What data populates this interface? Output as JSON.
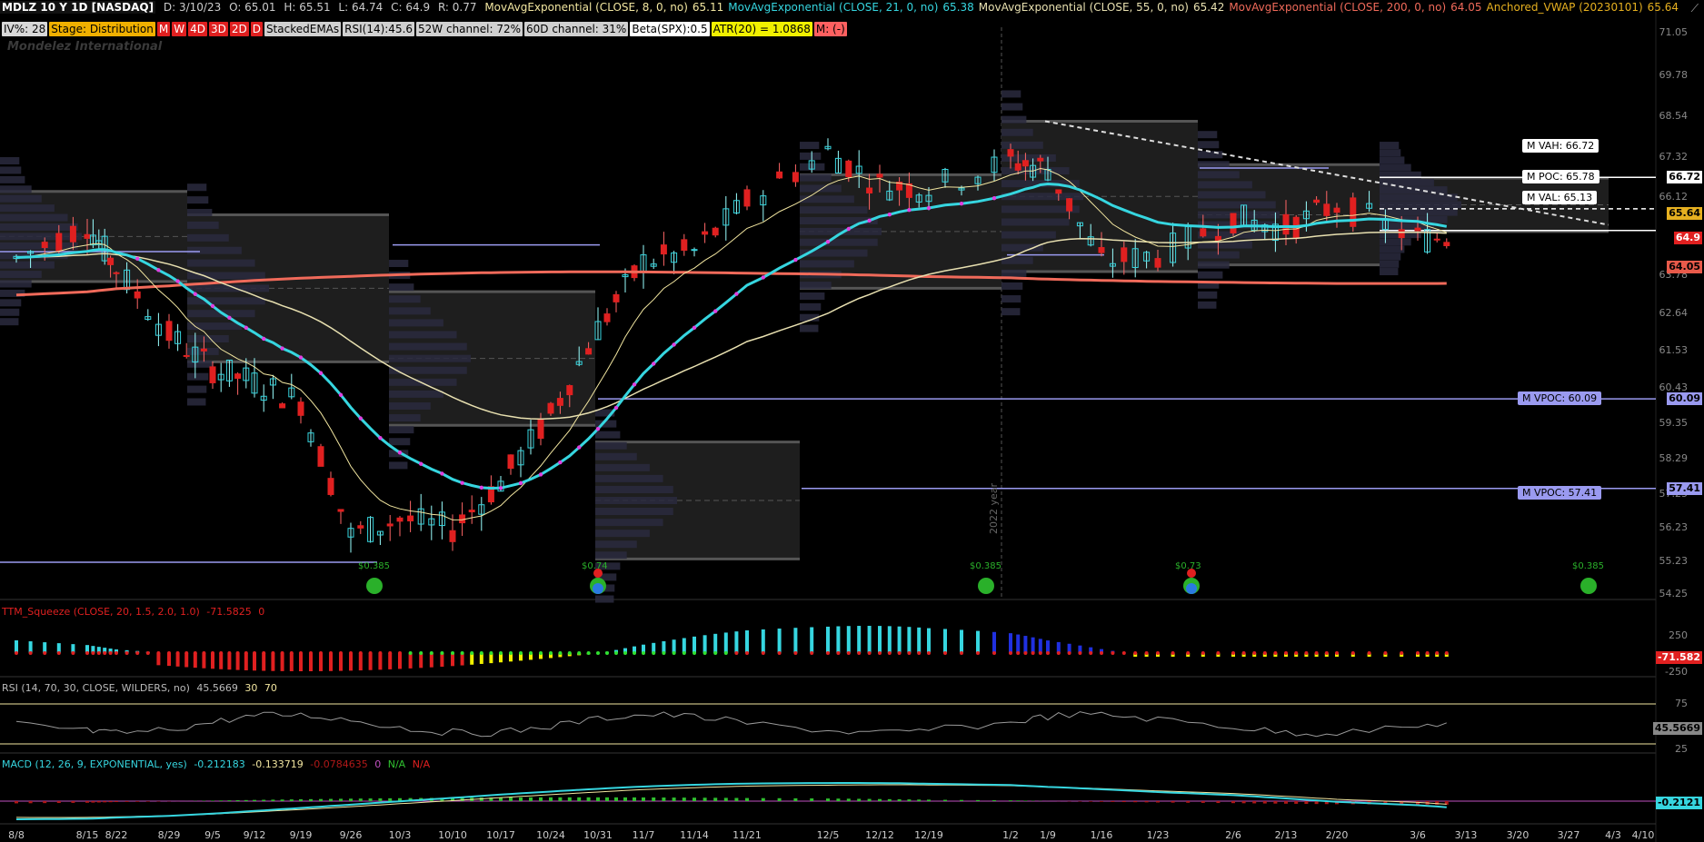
{
  "header": {
    "symbol": "MDLZ 10 Y 1D [NASDAQ]",
    "ohlc": [
      "D: 3/10/23",
      "O: 65.01",
      "H: 65.51",
      "L: 64.74",
      "C: 64.9",
      "R: 0.77"
    ],
    "studies": [
      {
        "label": "MovAvgExponential (CLOSE, 8, 0, no)",
        "value": "65.11",
        "color": "#f2e6a0"
      },
      {
        "label": "MovAvgExponential (CLOSE, 21, 0, no)",
        "value": "65.38",
        "color": "#36d6e0"
      },
      {
        "label": "MovAvgExponential (CLOSE, 55, 0, no)",
        "value": "65.42",
        "color": "#e8e0b0"
      },
      {
        "label": "MovAvgExponential (CLOSE, 200, 0, no)",
        "value": "64.05",
        "color": "#f06a5a"
      },
      {
        "label": "Anchored_VWAP (20230101)",
        "value": "65.64",
        "color": "#e6b020"
      }
    ]
  },
  "badges": [
    {
      "text": "IV%: 28",
      "bg": "#d8d8d8",
      "fg": "#000"
    },
    {
      "text": "Stage: Distribution",
      "bg": "#f0b000",
      "fg": "#000"
    },
    {
      "text": "M",
      "bg": "#e02020",
      "fg": "#fff"
    },
    {
      "text": "W",
      "bg": "#e02020",
      "fg": "#fff"
    },
    {
      "text": "4D",
      "bg": "#e02020",
      "fg": "#fff"
    },
    {
      "text": "3D",
      "bg": "#e02020",
      "fg": "#fff"
    },
    {
      "text": "2D",
      "bg": "#e02020",
      "fg": "#fff"
    },
    {
      "text": "D",
      "bg": "#e02020",
      "fg": "#fff"
    },
    {
      "text": "StackedEMAs",
      "bg": "#d0d0d0",
      "fg": "#000"
    },
    {
      "text": "RSI(14):45.6",
      "bg": "#d0d0d0",
      "fg": "#000"
    },
    {
      "text": "52W channel: 72%",
      "bg": "#d0d0d0",
      "fg": "#000"
    },
    {
      "text": "60D channel: 31%",
      "bg": "#d0d0d0",
      "fg": "#000"
    },
    {
      "text": "Beta(SPX):0.5",
      "bg": "#ffffff",
      "fg": "#000"
    },
    {
      "text": "ATR(20) = 1.0868",
      "bg": "#f0f000",
      "fg": "#000"
    },
    {
      "text": "M: (-)",
      "bg": "#ff6060",
      "fg": "#000"
    }
  ],
  "watermark": "Mondelez International",
  "price_axis": {
    "ticks": [
      "71.05",
      "69.78",
      "68.54",
      "67.32",
      "66.12",
      "63.78",
      "62.64",
      "61.53",
      "60.43",
      "59.35",
      "58.29",
      "57.25",
      "56.23",
      "55.23",
      "54.25"
    ],
    "labels": [
      {
        "text": "66.72",
        "bg": "#ffffff",
        "fg": "#000"
      },
      {
        "text": "65.64",
        "bg": "#e6b020",
        "fg": "#000"
      },
      {
        "text": "64.9",
        "bg": "#e02020",
        "fg": "#fff"
      },
      {
        "text": "64.05",
        "bg": "#e85a4a",
        "fg": "#000"
      },
      {
        "text": "60.09",
        "bg": "#9a9af0",
        "fg": "#000"
      },
      {
        "text": "57.41",
        "bg": "#9a9af0",
        "fg": "#000"
      }
    ]
  },
  "volume_profile_labels": [
    {
      "text": "M VAH: 66.72",
      "bg": "#ffffff",
      "fg": "#000"
    },
    {
      "text": "M POC: 65.78",
      "bg": "#ffffff",
      "fg": "#000"
    },
    {
      "text": "M VAL: 65.13",
      "bg": "#ffffff",
      "fg": "#000"
    },
    {
      "text": "M VPOC: 60.09",
      "bg": "#9a9af0",
      "fg": "#000"
    },
    {
      "text": "M VPOC: 57.41",
      "bg": "#9a9af0",
      "fg": "#000"
    }
  ],
  "dividends": [
    "$0.385",
    "$0.74",
    "$0.385",
    "$0.73",
    "$0.385"
  ],
  "year_marker": "2022 year",
  "squeeze": {
    "label": "TTM_Squeeze (CLOSE, 20, 1.5, 2.0, 1.0)",
    "value": "-71.5825",
    "extra": "0",
    "axis_ticks": [
      "250",
      "-250"
    ],
    "price_label": "-71.582"
  },
  "rsi": {
    "label": "RSI (14, 70, 30, CLOSE, WILDERS, no)",
    "value": "45.5669",
    "low": "30",
    "high": "70",
    "axis_ticks": [
      "75",
      "25"
    ],
    "price_label": "45.5669"
  },
  "macd": {
    "label": "MACD (12, 26, 9, EXPONENTIAL, yes)",
    "value": "-0.212183",
    "avg": "-0.133719",
    "diff": "-0.0784635",
    "zero": "0",
    "na1": "N/A",
    "na2": "N/A",
    "price_label": "-0.2121"
  },
  "x_axis": [
    "8/8",
    "8/15",
    "8/22",
    "8/29",
    "9/5",
    "9/12",
    "9/19",
    "9/26",
    "10/3",
    "10/10",
    "10/17",
    "10/24",
    "10/31",
    "11/7",
    "11/14",
    "11/21",
    "12/5",
    "12/12",
    "12/19",
    "1/2",
    "1/9",
    "1/16",
    "1/23",
    "2/6",
    "2/13",
    "2/20",
    "3/6",
    "3/13",
    "3/20",
    "3/27",
    "4/3",
    "4/10"
  ],
  "chart_data": {
    "type": "candlestick",
    "title": "MDLZ 10 Y 1D [NASDAQ]",
    "x_range": [
      "2022-08-08",
      "2023-04-10"
    ],
    "ylim": [
      54.25,
      71.05
    ],
    "approx_weekly_close": [
      {
        "week": "8/8",
        "close": 64.3
      },
      {
        "week": "8/15",
        "close": 65.3
      },
      {
        "week": "8/22",
        "close": 64.0
      },
      {
        "week": "8/29",
        "close": 62.0
      },
      {
        "week": "9/5",
        "close": 61.0
      },
      {
        "week": "9/12",
        "close": 60.6
      },
      {
        "week": "9/19",
        "close": 60.0
      },
      {
        "week": "9/26",
        "close": 56.0
      },
      {
        "week": "10/3",
        "close": 56.5
      },
      {
        "week": "10/10",
        "close": 56.2
      },
      {
        "week": "10/17",
        "close": 57.6
      },
      {
        "week": "10/24",
        "close": 59.6
      },
      {
        "week": "10/31",
        "close": 62.2
      },
      {
        "week": "11/7",
        "close": 64.2
      },
      {
        "week": "11/14",
        "close": 64.5
      },
      {
        "week": "11/21",
        "close": 66.0
      },
      {
        "week": "12/5",
        "close": 67.5
      },
      {
        "week": "12/12",
        "close": 66.5
      },
      {
        "week": "12/19",
        "close": 66.4
      },
      {
        "week": "1/2",
        "close": 67.2
      },
      {
        "week": "1/9",
        "close": 67.0
      },
      {
        "week": "1/16",
        "close": 64.2
      },
      {
        "week": "1/23",
        "close": 64.4
      },
      {
        "week": "2/6",
        "close": 65.5
      },
      {
        "week": "2/13",
        "close": 65.2
      },
      {
        "week": "2/20",
        "close": 65.9
      },
      {
        "week": "3/6",
        "close": 64.9
      }
    ],
    "lines": [
      {
        "name": "EMA 8",
        "last": 65.11
      },
      {
        "name": "EMA 21",
        "last": 65.38
      },
      {
        "name": "EMA 55",
        "last": 65.42
      },
      {
        "name": "EMA 200",
        "last": 64.05
      },
      {
        "name": "Anchored VWAP",
        "last": 65.64
      }
    ],
    "levels": [
      {
        "name": "M VAH",
        "value": 66.72
      },
      {
        "name": "M POC",
        "value": 65.78
      },
      {
        "name": "M VAL",
        "value": 65.13
      },
      {
        "name": "M VPOC",
        "value": 60.09
      },
      {
        "name": "M VPOC",
        "value": 57.41
      }
    ]
  }
}
